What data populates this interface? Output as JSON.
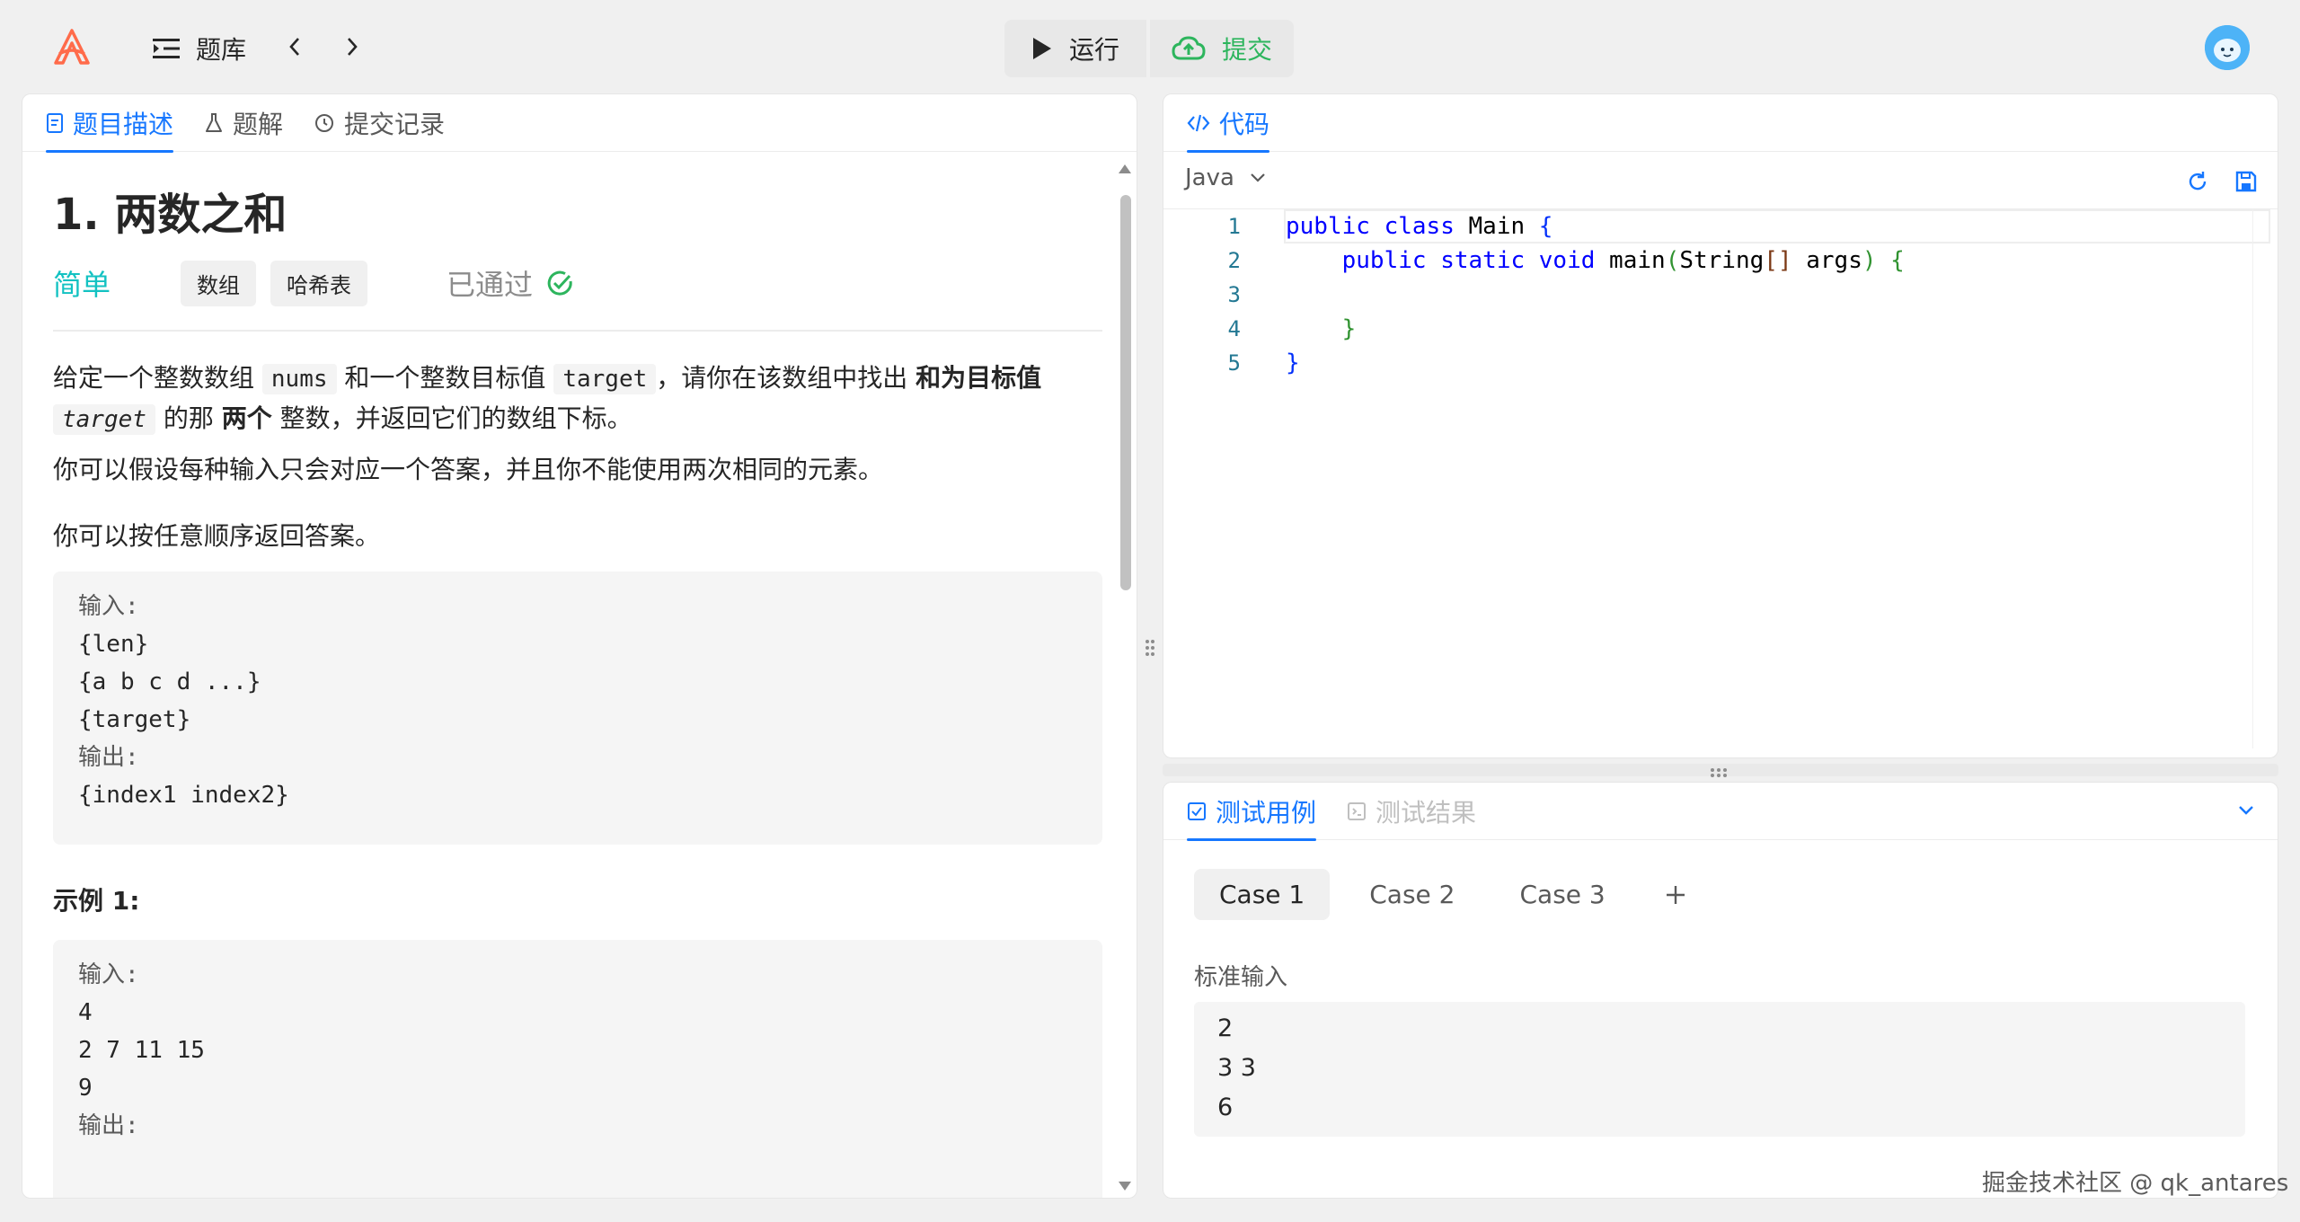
{
  "topbar": {
    "problems_label": "题库",
    "run_label": "运行",
    "submit_label": "提交"
  },
  "left_tabs": [
    {
      "label": "题目描述"
    },
    {
      "label": "题解"
    },
    {
      "label": "提交记录"
    }
  ],
  "problem": {
    "title": "1. 两数之和",
    "difficulty": "简单",
    "tags": [
      "数组",
      "哈希表"
    ],
    "status": "已通过",
    "p1": {
      "t1": "给定一个整数数组 ",
      "c1": "nums",
      "t2": " 和一个整数目标值 ",
      "c2": "target",
      "t3": "，请你在该数组中找出 ",
      "b1": "和为目标值",
      "c3": "target",
      "t4": " 的那 ",
      "b2": "两个",
      "t5": " 整数，并返回它们的数组下标。"
    },
    "p2": "你可以假设每种输入只会对应一个答案，并且你不能使用两次相同的元素。",
    "p3": "你可以按任意顺序返回答案。",
    "format_block": {
      "input_label": "输入:",
      "lines_in": [
        "{len}",
        "{a b c d ...}",
        "{target}"
      ],
      "output_label": "输出:",
      "lines_out": [
        "{index1 index2}"
      ]
    },
    "example1_heading": "示例 1:",
    "example1_block": {
      "input_label": "输入:",
      "lines": [
        "4",
        "2 7 11 15",
        "9"
      ],
      "output_label": "输出:"
    }
  },
  "code": {
    "tab_label": "代码",
    "language": "Java",
    "lines": [
      {
        "n": "1",
        "parts": [
          [
            "kw",
            "public"
          ],
          [
            "t",
            " "
          ],
          [
            "kw",
            "class"
          ],
          [
            "t",
            " Main "
          ],
          [
            "br1",
            "{"
          ]
        ]
      },
      {
        "n": "2",
        "parts": [
          [
            "t",
            "    "
          ],
          [
            "kw",
            "public"
          ],
          [
            "t",
            " "
          ],
          [
            "kw",
            "static"
          ],
          [
            "t",
            " "
          ],
          [
            "kw",
            "void"
          ],
          [
            "t",
            " main"
          ],
          [
            "br2",
            "("
          ],
          [
            "t",
            "String"
          ],
          [
            "br3",
            "[]"
          ],
          [
            "t",
            " args"
          ],
          [
            "br2",
            ")"
          ],
          [
            "t",
            " "
          ],
          [
            "br2",
            "{"
          ]
        ]
      },
      {
        "n": "3",
        "parts": []
      },
      {
        "n": "4",
        "parts": [
          [
            "t",
            "    "
          ],
          [
            "br2",
            "}"
          ]
        ]
      },
      {
        "n": "5",
        "parts": [
          [
            "br1",
            "}"
          ]
        ]
      }
    ]
  },
  "tests": {
    "tab_cases": "测试用例",
    "tab_results": "测试结果",
    "cases": [
      "Case 1",
      "Case 2",
      "Case 3"
    ],
    "input_label": "标准输入",
    "input_value": "2\n3 3\n6"
  },
  "watermark": "掘金技术社区 @ qk_antares",
  "colors": {
    "accent": "#1677ff",
    "easy": "#13c2c2",
    "success": "#2db55d"
  }
}
